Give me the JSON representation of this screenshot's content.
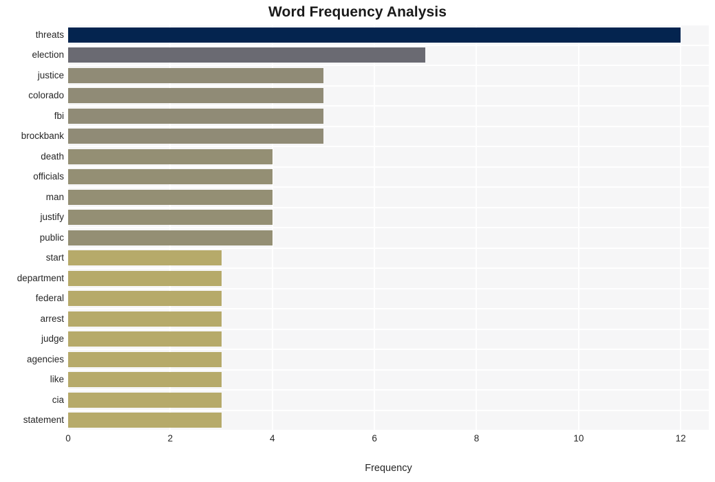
{
  "chart_data": {
    "type": "bar",
    "orientation": "horizontal",
    "title": "Word Frequency Analysis",
    "xlabel": "Frequency",
    "ylabel": "",
    "xlim": [
      0,
      12.55
    ],
    "ylim": [
      0,
      20
    ],
    "grid": true,
    "legend": false,
    "xticks": [
      0,
      2,
      4,
      6,
      8,
      10,
      12
    ],
    "xtick_labels": [
      "0",
      "2",
      "4",
      "6",
      "8",
      "10",
      "12"
    ],
    "categories": [
      "threats",
      "election",
      "justice",
      "colorado",
      "fbi",
      "brockbank",
      "death",
      "officials",
      "man",
      "justify",
      "public",
      "start",
      "department",
      "federal",
      "arrest",
      "judge",
      "agencies",
      "like",
      "cia",
      "statement"
    ],
    "values": [
      12,
      7,
      5,
      5,
      5,
      5,
      4,
      4,
      4,
      4,
      4,
      3,
      3,
      3,
      3,
      3,
      3,
      3,
      3,
      3
    ],
    "bar_colors": [
      "#04244f",
      "#6a6a72",
      "#908b76",
      "#908b76",
      "#908b76",
      "#908b76",
      "#948f74",
      "#948f74",
      "#948f74",
      "#948f74",
      "#948f74",
      "#b6aa6a",
      "#b6aa6a",
      "#b6aa6a",
      "#b6aa6a",
      "#b6aa6a",
      "#b6aa6a",
      "#b6aa6a",
      "#b6aa6a",
      "#b6aa6a"
    ],
    "plot_background": "#f6f6f7",
    "gridline_color": "#ffffff",
    "text_color": "#262626",
    "title_color": "#1a1a1a"
  }
}
